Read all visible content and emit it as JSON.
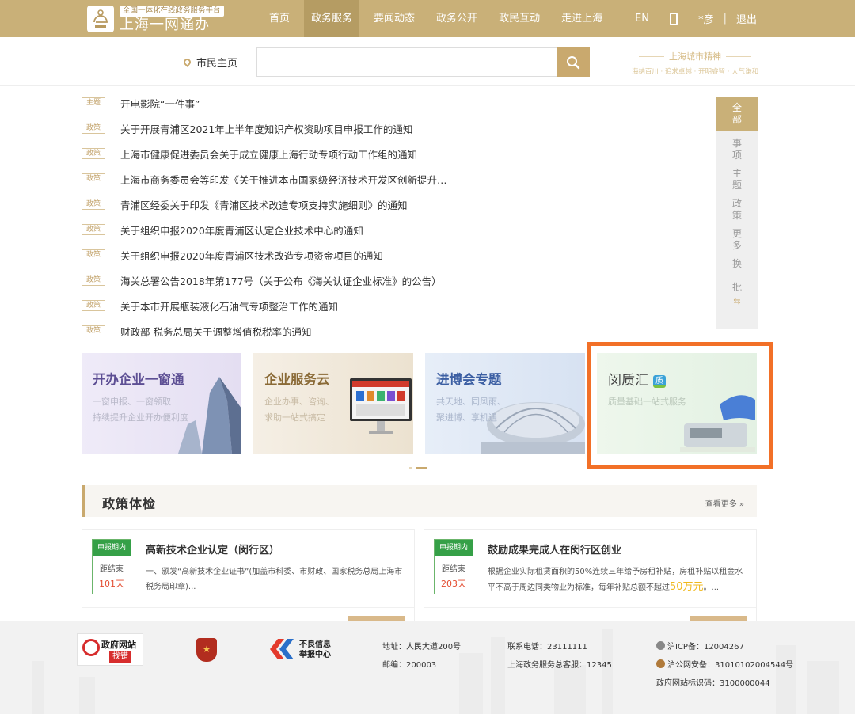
{
  "header": {
    "logo_subtitle": "全国一体化在线政务服务平台",
    "logo_title": "上海一网通办",
    "nav": [
      "首页",
      "政务服务",
      "要闻动态",
      "政务公开",
      "政民互动",
      "走进上海"
    ],
    "active_nav": "政务服务",
    "lang": "EN",
    "user": "*彦",
    "separator": "|",
    "logout": "退出"
  },
  "search": {
    "location": "市民主页",
    "placeholder": "",
    "spirit_title": "上海城市精神",
    "spirit_sub": "海纳百川 · 追求卓越 · 开明睿智 · 大气谦和"
  },
  "list": [
    {
      "tag": "主题",
      "title": "开电影院“一件事”"
    },
    {
      "tag": "政策",
      "title": "关于开展青浦区2021年上半年度知识产权资助项目申报工作的通知"
    },
    {
      "tag": "政策",
      "title": "上海市健康促进委员会关于成立健康上海行动专项行动工作组的通知"
    },
    {
      "tag": "政策",
      "title": "上海市商务委员会等印发《关于推进本市国家级经济技术开发区创新提升…"
    },
    {
      "tag": "政策",
      "title": "青浦区经委关于印发《青浦区技术改造专项支持实施细则》的通知"
    },
    {
      "tag": "政策",
      "title": "关于组织申报2020年度青浦区认定企业技术中心的通知"
    },
    {
      "tag": "政策",
      "title": "关于组织申报2020年度青浦区技术改造专项资金项目的通知"
    },
    {
      "tag": "政策",
      "title": "海关总署公告2018年第177号（关于公布《海关认证企业标准》的公告）"
    },
    {
      "tag": "政策",
      "title": "关于本市开展瓶装液化石油气专项整治工作的通知"
    },
    {
      "tag": "政策",
      "title": "财政部 税务总局关于调整增值税税率的通知"
    }
  ],
  "side_tabs": [
    "全部",
    "事项",
    "主题",
    "政策",
    "更多",
    "换一批"
  ],
  "banners": [
    {
      "title": "开办企业一窗通",
      "desc1": "一窗申报、一窗领取",
      "desc2": "持续提升企业开办便利度"
    },
    {
      "title": "企业服务云",
      "desc1": "企业办事、咨询、",
      "desc2": "求助一站式搞定"
    },
    {
      "title": "进博会专题",
      "desc1": "共天地、同风雨、",
      "desc2": "聚进博、享机遇"
    },
    {
      "title": "闵质汇",
      "badge": "质",
      "desc1": "质量基础一站式服务",
      "desc2": ""
    }
  ],
  "policy": {
    "title": "政策体检",
    "more": "查看更多 »",
    "cards": [
      {
        "badge_top": "申报期内",
        "badge_mid": "距结束",
        "badge_days": "101天",
        "title": "高新技术企业认定（闵行区）",
        "desc": "一、颁发“高新技术企业证书”(加盖市科委、市财政、国家税务总局上海市税务局印章)..."
      },
      {
        "badge_top": "申报期内",
        "badge_mid": "距结束",
        "badge_days": "203天",
        "title": "鼓励成果完成人在闵行区创业",
        "desc": "根据企业实际租赁面积的50%连续三年给予房租补贴，房租补贴以租金水平不高于周边同类物业为标准，每年补贴总额不超过",
        "highlight": "50万元",
        "tail": "。..."
      }
    ]
  },
  "footer": {
    "logo1_title": "政府网站",
    "logo1_sub": "找错",
    "logo3_text": "不良信息\n举报中心",
    "address": "地址：人民大道200号",
    "postcode": "邮编：200003",
    "phone": "联系电话：23111111",
    "hotline": "上海政务服务总客服：12345",
    "icp": "沪ICP备：12004267",
    "security": "沪公网安备：31010102004544号",
    "site_id": "政府网站标识码：3100000044"
  },
  "colors": {
    "brand": "#c9b078",
    "accent": "#c9a96e",
    "highlight_border": "#f27027",
    "badge_green": "#35a047"
  }
}
